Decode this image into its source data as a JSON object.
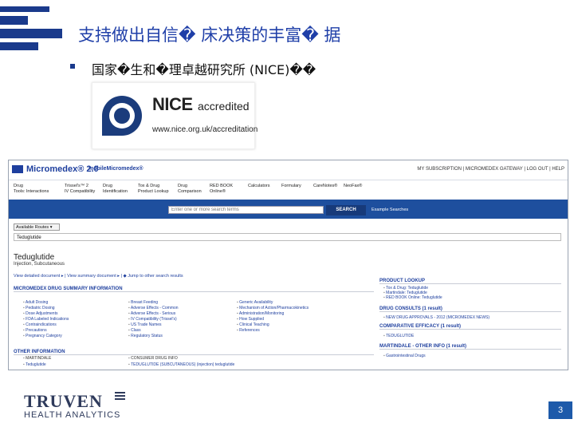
{
  "slide": {
    "title": "支持做出自信� 床决策的丰富� 据",
    "bullet": "国家�生和�理卓越研究所 (NICE)��",
    "page_number": "3"
  },
  "nice_logo": {
    "word": "NICE",
    "accredited": "accredited",
    "url": "www.nice.org.uk/accreditation"
  },
  "micromedex": {
    "title": "Micromedex® 2.0",
    "mobile": "mobileMicromedex®",
    "top_links": "MY SUBSCRIPTION | MICROMEDEX GATEWAY | LOG OUT | HELP",
    "tools": [
      {
        "line1": "Drug",
        "line2": "Tools: Interactions"
      },
      {
        "line1": "Trissel's™ 2",
        "line2": "IV Compatibility"
      },
      {
        "line1": "Drug",
        "line2": "Identification"
      },
      {
        "line1": "Tox & Drug",
        "line2": "Product Lookup"
      },
      {
        "line1": "Drug",
        "line2": "Comparison"
      },
      {
        "line1": "RED BOOK",
        "line2": "Online®"
      },
      {
        "line1": "",
        "line2": "Calculators"
      },
      {
        "line1": "",
        "line2": "Formulary"
      },
      {
        "line1": "",
        "line2": "CareNotes®"
      },
      {
        "line1": "",
        "line2": "NeoFax®"
      }
    ],
    "search_placeholder": "Enter one or more search terms",
    "search_button": "SEARCH",
    "examples": "Example Searches",
    "routes_select": "Available Routes",
    "query": "Teduglutide",
    "drug_name": "Teduglutide",
    "drug_route": "Injection, Subcutaneous",
    "doc_links": "View detailed document ▸  |  View summary document ▸  |  ◆ Jump to other search results",
    "summary_header": "MICROMEDEX DRUG SUMMARY INFORMATION",
    "summary_col1": [
      "Adult Dosing",
      "Pediatric Dosing",
      "Dose Adjustments",
      "FDA Labeled Indications",
      "Contraindications",
      "Precautions",
      "Pregnancy Category"
    ],
    "summary_col2": [
      "Breast Feeding",
      "Adverse Effects - Common",
      "Adverse Effects - Serious",
      "IV Compatibility (Trissel's)",
      "US Trade Names",
      "Class",
      "Regulatory Status"
    ],
    "summary_col3": [
      "Generic Availability",
      "Mechanism of Action/Pharmacokinetics",
      "Administration/Monitoring",
      "How Supplied",
      "Clinical Teaching",
      "References"
    ],
    "other_header": "OTHER INFORMATION",
    "martindale_sub": "MARTINDALE",
    "martindale_items": [
      "Teduglutide"
    ],
    "consumer_sub": "CONSUMER DRUG INFO",
    "consumer_items": [
      "TEDUGLUTIDE (SUBCUTANEOUS) (injection) teduglutide"
    ],
    "side_product_header": "PRODUCT LOOKUP",
    "side_product_items": [
      "Tox & Drug: Teduglutide",
      "Martindale: Teduglutide",
      "RED BOOK Online: Teduglutide"
    ],
    "side_consults_header": "DRUG CONSULTS (1 result)",
    "side_consults_items": [
      "NEW DRUG APPROVALS - 2012 (MICROMEDEX NEWS)"
    ],
    "side_efficacy_header": "COMPARATIVE EFFICACY (1 result)",
    "side_efficacy_items": [
      "TEDUGLUTIDE"
    ],
    "side_martindale_header": "MARTINDALE - OTHER INFO (1 result)",
    "side_martindale_items": [
      "Gastrointestinal Drugs"
    ]
  },
  "truven": {
    "name": "TRUVEN",
    "tagline": "HEALTH ANALYTICS"
  }
}
